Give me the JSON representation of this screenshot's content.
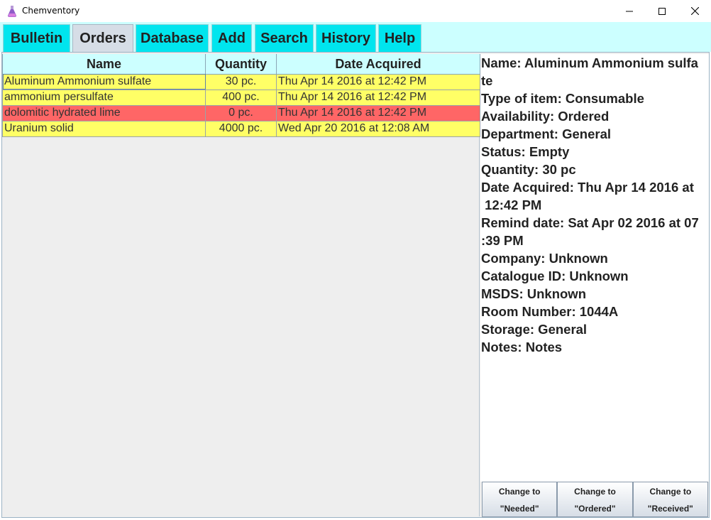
{
  "window": {
    "title": "Chemventory",
    "icon": "flask-icon",
    "controls": [
      "minimize-icon",
      "maximize-icon",
      "close-icon"
    ]
  },
  "tabs": [
    {
      "label": "Bulletin",
      "active": false
    },
    {
      "label": "Orders",
      "active": true
    },
    {
      "label": "Database",
      "active": false
    },
    {
      "label": "Add",
      "active": false
    },
    {
      "label": "Search",
      "active": false
    },
    {
      "label": "History",
      "active": false
    },
    {
      "label": "Help",
      "active": false
    }
  ],
  "table": {
    "columns": [
      "Name",
      "Quantity",
      "Date Acquired"
    ],
    "rows": [
      {
        "name": "Aluminum Ammonium sulfate",
        "quantity": "30 pc.",
        "date": "Thu Apr 14 2016 at 12:42 PM",
        "color": "#ffff66",
        "selected": true
      },
      {
        "name": "ammonium persulfate",
        "quantity": "400 pc.",
        "date": "Thu Apr 14 2016 at 12:42 PM",
        "color": "#ffff66",
        "selected": false
      },
      {
        "name": "dolomitic hydrated lime",
        "quantity": "0 pc.",
        "date": "Thu Apr 14 2016 at 12:42 PM",
        "color": "#ff6666",
        "selected": false
      },
      {
        "name": "Uranium solid",
        "quantity": "4000 pc.",
        "date": "Wed Apr 20 2016 at 12:08 AM",
        "color": "#ffff66",
        "selected": false
      }
    ]
  },
  "details": {
    "lines": [
      "Name: Aluminum Ammonium sulfa",
      "te",
      "Type of item: Consumable",
      "Availability: Ordered",
      "Department: General",
      "Status: Empty",
      "Quantity: 30 pc",
      "Date Acquired: Thu Apr 14 2016 at",
      " 12:42 PM",
      "Remind date: Sat Apr 02 2016 at 07",
      ":39 PM",
      "Company: Unknown",
      "Catalogue ID: Unknown",
      "MSDS: Unknown",
      "Room Number: 1044A",
      "Storage: General",
      "Notes: Notes"
    ]
  },
  "actions": [
    {
      "line1": "Change to",
      "line2": "\"Needed\""
    },
    {
      "line1": "Change to",
      "line2": "\"Ordered\""
    },
    {
      "line1": "Change to",
      "line2": "\"Received\""
    }
  ],
  "colors": {
    "tab_bg": "#00e5ee",
    "tab_active_bg": "#d6dde6",
    "tabbar_bg": "#ccffff",
    "row_ok": "#ffff66",
    "row_empty": "#ff6666"
  }
}
